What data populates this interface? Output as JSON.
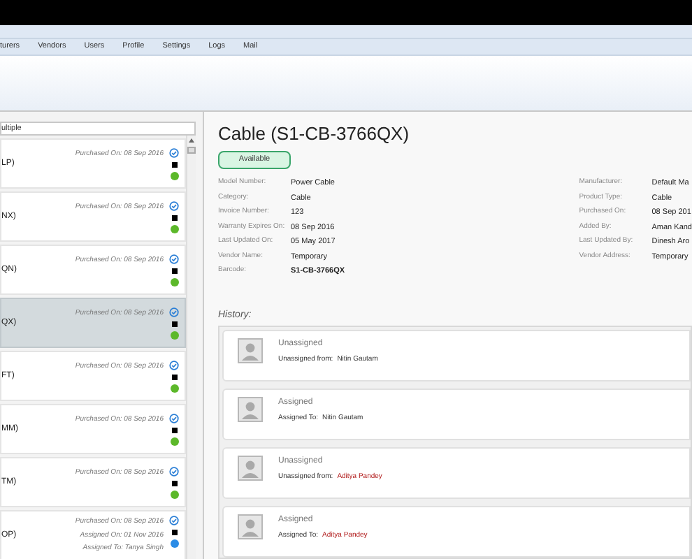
{
  "menu": [
    "turers",
    "Vendors",
    "Users",
    "Profile",
    "Settings",
    "Logs",
    "Mail"
  ],
  "list_header": "ultiple",
  "assets": [
    {
      "code": "LP)",
      "lines": [
        "Purchased On: 08 Sep 2016"
      ],
      "selected": false,
      "color": "#5cb82a"
    },
    {
      "code": "NX)",
      "lines": [
        "Purchased On: 08 Sep 2016"
      ],
      "selected": false,
      "color": "#5cb82a"
    },
    {
      "code": "QN)",
      "lines": [
        "Purchased On: 08 Sep 2016"
      ],
      "selected": false,
      "color": "#5cb82a"
    },
    {
      "code": "QX)",
      "lines": [
        "Purchased On: 08 Sep 2016"
      ],
      "selected": true,
      "color": "#5cb82a"
    },
    {
      "code": "FT)",
      "lines": [
        "Purchased On: 08 Sep 2016"
      ],
      "selected": false,
      "color": "#5cb82a"
    },
    {
      "code": "MM)",
      "lines": [
        "Purchased On: 08 Sep 2016"
      ],
      "selected": false,
      "color": "#5cb82a"
    },
    {
      "code": "TM)",
      "lines": [
        "Purchased On: 08 Sep 2016"
      ],
      "selected": false,
      "color": "#5cb82a"
    },
    {
      "code": "OP)",
      "lines": [
        "Purchased On: 08 Sep 2016",
        "Assigned On: 01 Nov 2016",
        "Assigned To: Tanya Singh"
      ],
      "selected": false,
      "color": "#2b8ce6"
    }
  ],
  "detail": {
    "title": "Cable (S1-CB-3766QX)",
    "status": "Available",
    "left_fields": [
      {
        "label": "Model Number:",
        "value": "Power Cable",
        "bold": false
      },
      {
        "label": "Category:",
        "value": "Cable",
        "bold": false
      },
      {
        "label": "Invoice Number:",
        "value": "123",
        "bold": false
      },
      {
        "label": "Warranty Expires On:",
        "value": "08 Sep 2016",
        "bold": false
      },
      {
        "label": "Last Updated On:",
        "value": "05 May 2017",
        "bold": false
      },
      {
        "label": "Vendor Name:",
        "value": "Temporary",
        "bold": false
      },
      {
        "label": "Barcode:",
        "value": "S1-CB-3766QX",
        "bold": true
      }
    ],
    "right_fields": [
      {
        "label": "Manufacturer:",
        "value": "Default Ma",
        "bold": false
      },
      {
        "label": "Product Type:",
        "value": "Cable",
        "bold": false
      },
      {
        "label": "Purchased On:",
        "value": "08 Sep 201",
        "bold": false
      },
      {
        "label": "Added By:",
        "value": "Aman Kand",
        "bold": false
      },
      {
        "label": "Last Updated By:",
        "value": "Dinesh  Aro",
        "bold": false
      },
      {
        "label": "Vendor Address:",
        "value": "Temporary",
        "bold": false
      }
    ]
  },
  "history_label": "History:",
  "history": [
    {
      "action": "Unassigned",
      "detail": "Unassigned from:",
      "person": "Nitin Gautam",
      "highlighted": false
    },
    {
      "action": "Assigned",
      "detail": "Assigned To:",
      "person": "Nitin Gautam",
      "highlighted": false
    },
    {
      "action": "Unassigned",
      "detail": "Unassigned from:",
      "person": "Aditya Pandey",
      "highlighted": true
    },
    {
      "action": "Assigned",
      "detail": "Assigned To:",
      "person": "Aditya Pandey",
      "highlighted": true
    }
  ]
}
